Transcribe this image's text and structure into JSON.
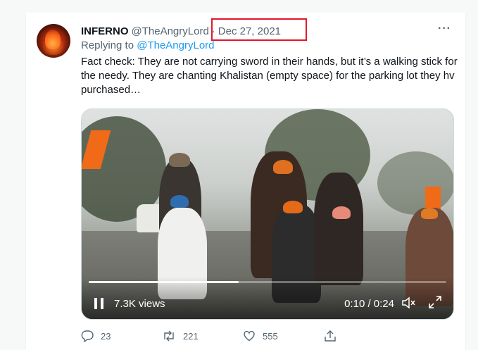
{
  "tweet": {
    "author_name": "INFERNO",
    "author_handle": "@TheAngryLord",
    "separator": "·",
    "date": "Dec 27, 2021",
    "more_label": "···",
    "replying_prefix": "Replying to",
    "replying_to": "@TheAngryLord",
    "text": "Fact check: They are not carrying sword in their hands, but it’s a walking stick for the needy. They are chanting Khalistan (empty space) for the parking lot they hv purchased…",
    "highlight_color": "#e3172b"
  },
  "video": {
    "views": "7.3K views",
    "time": "0:10 / 0:24",
    "progress": 0.42,
    "pause_icon": "pause-icon",
    "mute_icon": "mute-icon",
    "expand_icon": "expand-icon"
  },
  "actions": {
    "replies": "23",
    "retweets": "221",
    "likes": "555"
  }
}
